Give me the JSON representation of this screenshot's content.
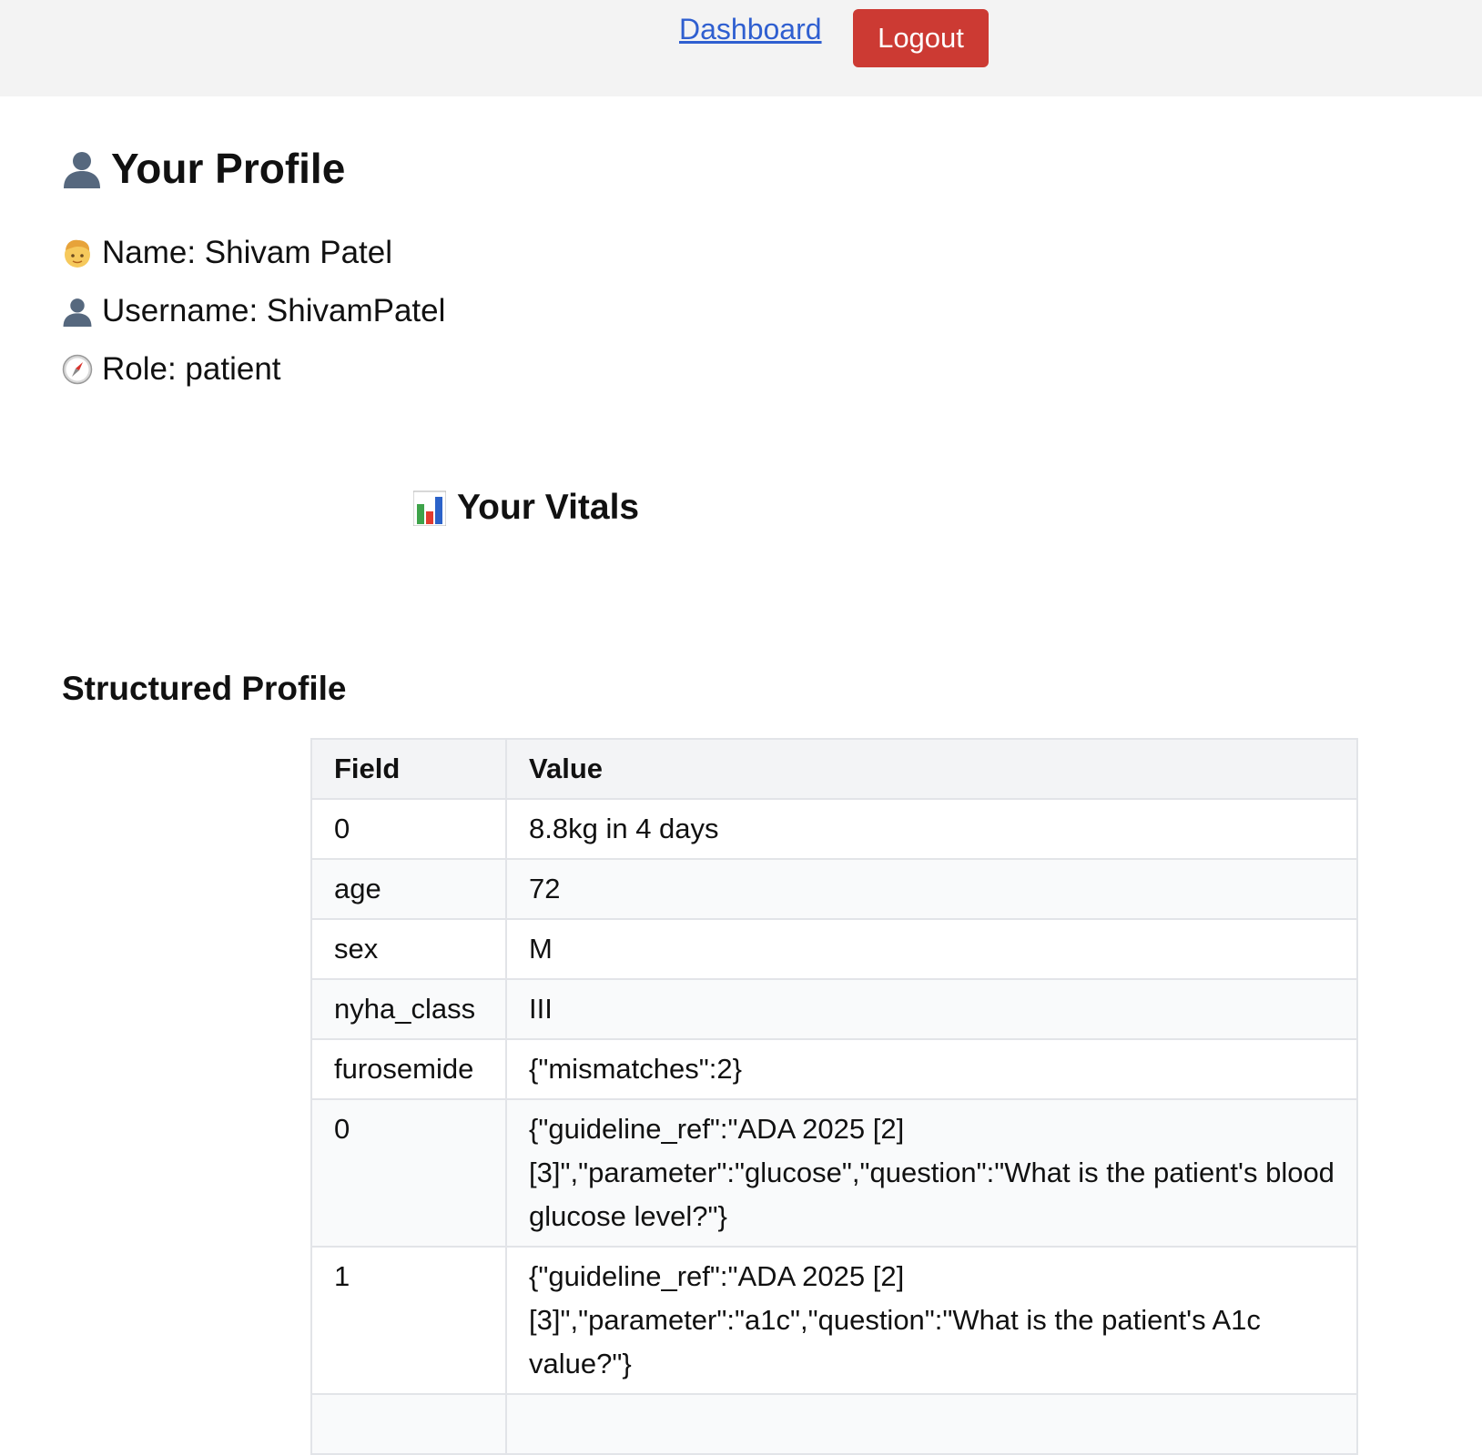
{
  "nav": {
    "dashboard_label": "Dashboard",
    "logout_label": "Logout"
  },
  "profile": {
    "title": "Your Profile",
    "name_line": "Name: Shivam Patel",
    "username_line": "Username: ShivamPatel",
    "role_line": "Role: patient"
  },
  "vitals": {
    "title": "Your Vitals"
  },
  "structured_profile": {
    "title": "Structured Profile",
    "columns": [
      "Field",
      "Value"
    ],
    "rows": [
      {
        "field": "0",
        "value": "8.8kg in 4 days"
      },
      {
        "field": "age",
        "value": "72"
      },
      {
        "field": "sex",
        "value": "M"
      },
      {
        "field": "nyha_class",
        "value": "III"
      },
      {
        "field": "furosemide",
        "value": "{\"mismatches\":2}"
      },
      {
        "field": "0",
        "value": "{\"guideline_ref\":\"ADA 2025 [2][3]\",\"parameter\":\"glucose\",\"question\":\"What is the patient's blood glucose level?\"}"
      },
      {
        "field": "1",
        "value": "{\"guideline_ref\":\"ADA 2025 [2][3]\",\"parameter\":\"a1c\",\"question\":\"What is the patient's A1c value?\"}"
      },
      {
        "field": "",
        "value": ""
      }
    ]
  },
  "icons": {
    "profile_title": "person-silhouette-icon",
    "name": "person-face-icon",
    "username": "person-silhouette-icon",
    "role": "compass-icon",
    "vitals": "bar-chart-icon"
  },
  "colors": {
    "topbar_bg": "#f3f3f3",
    "link": "#2f5fd0",
    "logout_bg": "#cc3a33",
    "table_border": "#e2e4e8",
    "table_header_bg": "#f3f4f6"
  }
}
